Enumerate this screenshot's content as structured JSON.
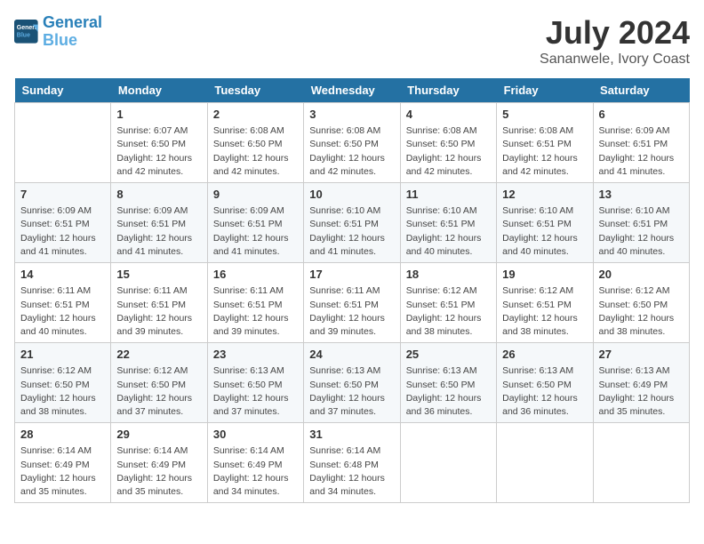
{
  "header": {
    "logo_line1": "General",
    "logo_line2": "Blue",
    "month": "July 2024",
    "location": "Sananwele, Ivory Coast"
  },
  "days_of_week": [
    "Sunday",
    "Monday",
    "Tuesday",
    "Wednesday",
    "Thursday",
    "Friday",
    "Saturday"
  ],
  "weeks": [
    [
      {
        "day": "",
        "info": ""
      },
      {
        "day": "1",
        "info": "Sunrise: 6:07 AM\nSunset: 6:50 PM\nDaylight: 12 hours\nand 42 minutes."
      },
      {
        "day": "2",
        "info": "Sunrise: 6:08 AM\nSunset: 6:50 PM\nDaylight: 12 hours\nand 42 minutes."
      },
      {
        "day": "3",
        "info": "Sunrise: 6:08 AM\nSunset: 6:50 PM\nDaylight: 12 hours\nand 42 minutes."
      },
      {
        "day": "4",
        "info": "Sunrise: 6:08 AM\nSunset: 6:50 PM\nDaylight: 12 hours\nand 42 minutes."
      },
      {
        "day": "5",
        "info": "Sunrise: 6:08 AM\nSunset: 6:51 PM\nDaylight: 12 hours\nand 42 minutes."
      },
      {
        "day": "6",
        "info": "Sunrise: 6:09 AM\nSunset: 6:51 PM\nDaylight: 12 hours\nand 41 minutes."
      }
    ],
    [
      {
        "day": "7",
        "info": "Sunrise: 6:09 AM\nSunset: 6:51 PM\nDaylight: 12 hours\nand 41 minutes."
      },
      {
        "day": "8",
        "info": "Sunrise: 6:09 AM\nSunset: 6:51 PM\nDaylight: 12 hours\nand 41 minutes."
      },
      {
        "day": "9",
        "info": "Sunrise: 6:09 AM\nSunset: 6:51 PM\nDaylight: 12 hours\nand 41 minutes."
      },
      {
        "day": "10",
        "info": "Sunrise: 6:10 AM\nSunset: 6:51 PM\nDaylight: 12 hours\nand 41 minutes."
      },
      {
        "day": "11",
        "info": "Sunrise: 6:10 AM\nSunset: 6:51 PM\nDaylight: 12 hours\nand 40 minutes."
      },
      {
        "day": "12",
        "info": "Sunrise: 6:10 AM\nSunset: 6:51 PM\nDaylight: 12 hours\nand 40 minutes."
      },
      {
        "day": "13",
        "info": "Sunrise: 6:10 AM\nSunset: 6:51 PM\nDaylight: 12 hours\nand 40 minutes."
      }
    ],
    [
      {
        "day": "14",
        "info": "Sunrise: 6:11 AM\nSunset: 6:51 PM\nDaylight: 12 hours\nand 40 minutes."
      },
      {
        "day": "15",
        "info": "Sunrise: 6:11 AM\nSunset: 6:51 PM\nDaylight: 12 hours\nand 39 minutes."
      },
      {
        "day": "16",
        "info": "Sunrise: 6:11 AM\nSunset: 6:51 PM\nDaylight: 12 hours\nand 39 minutes."
      },
      {
        "day": "17",
        "info": "Sunrise: 6:11 AM\nSunset: 6:51 PM\nDaylight: 12 hours\nand 39 minutes."
      },
      {
        "day": "18",
        "info": "Sunrise: 6:12 AM\nSunset: 6:51 PM\nDaylight: 12 hours\nand 38 minutes."
      },
      {
        "day": "19",
        "info": "Sunrise: 6:12 AM\nSunset: 6:51 PM\nDaylight: 12 hours\nand 38 minutes."
      },
      {
        "day": "20",
        "info": "Sunrise: 6:12 AM\nSunset: 6:50 PM\nDaylight: 12 hours\nand 38 minutes."
      }
    ],
    [
      {
        "day": "21",
        "info": "Sunrise: 6:12 AM\nSunset: 6:50 PM\nDaylight: 12 hours\nand 38 minutes."
      },
      {
        "day": "22",
        "info": "Sunrise: 6:12 AM\nSunset: 6:50 PM\nDaylight: 12 hours\nand 37 minutes."
      },
      {
        "day": "23",
        "info": "Sunrise: 6:13 AM\nSunset: 6:50 PM\nDaylight: 12 hours\nand 37 minutes."
      },
      {
        "day": "24",
        "info": "Sunrise: 6:13 AM\nSunset: 6:50 PM\nDaylight: 12 hours\nand 37 minutes."
      },
      {
        "day": "25",
        "info": "Sunrise: 6:13 AM\nSunset: 6:50 PM\nDaylight: 12 hours\nand 36 minutes."
      },
      {
        "day": "26",
        "info": "Sunrise: 6:13 AM\nSunset: 6:50 PM\nDaylight: 12 hours\nand 36 minutes."
      },
      {
        "day": "27",
        "info": "Sunrise: 6:13 AM\nSunset: 6:49 PM\nDaylight: 12 hours\nand 35 minutes."
      }
    ],
    [
      {
        "day": "28",
        "info": "Sunrise: 6:14 AM\nSunset: 6:49 PM\nDaylight: 12 hours\nand 35 minutes."
      },
      {
        "day": "29",
        "info": "Sunrise: 6:14 AM\nSunset: 6:49 PM\nDaylight: 12 hours\nand 35 minutes."
      },
      {
        "day": "30",
        "info": "Sunrise: 6:14 AM\nSunset: 6:49 PM\nDaylight: 12 hours\nand 34 minutes."
      },
      {
        "day": "31",
        "info": "Sunrise: 6:14 AM\nSunset: 6:48 PM\nDaylight: 12 hours\nand 34 minutes."
      },
      {
        "day": "",
        "info": ""
      },
      {
        "day": "",
        "info": ""
      },
      {
        "day": "",
        "info": ""
      }
    ]
  ]
}
